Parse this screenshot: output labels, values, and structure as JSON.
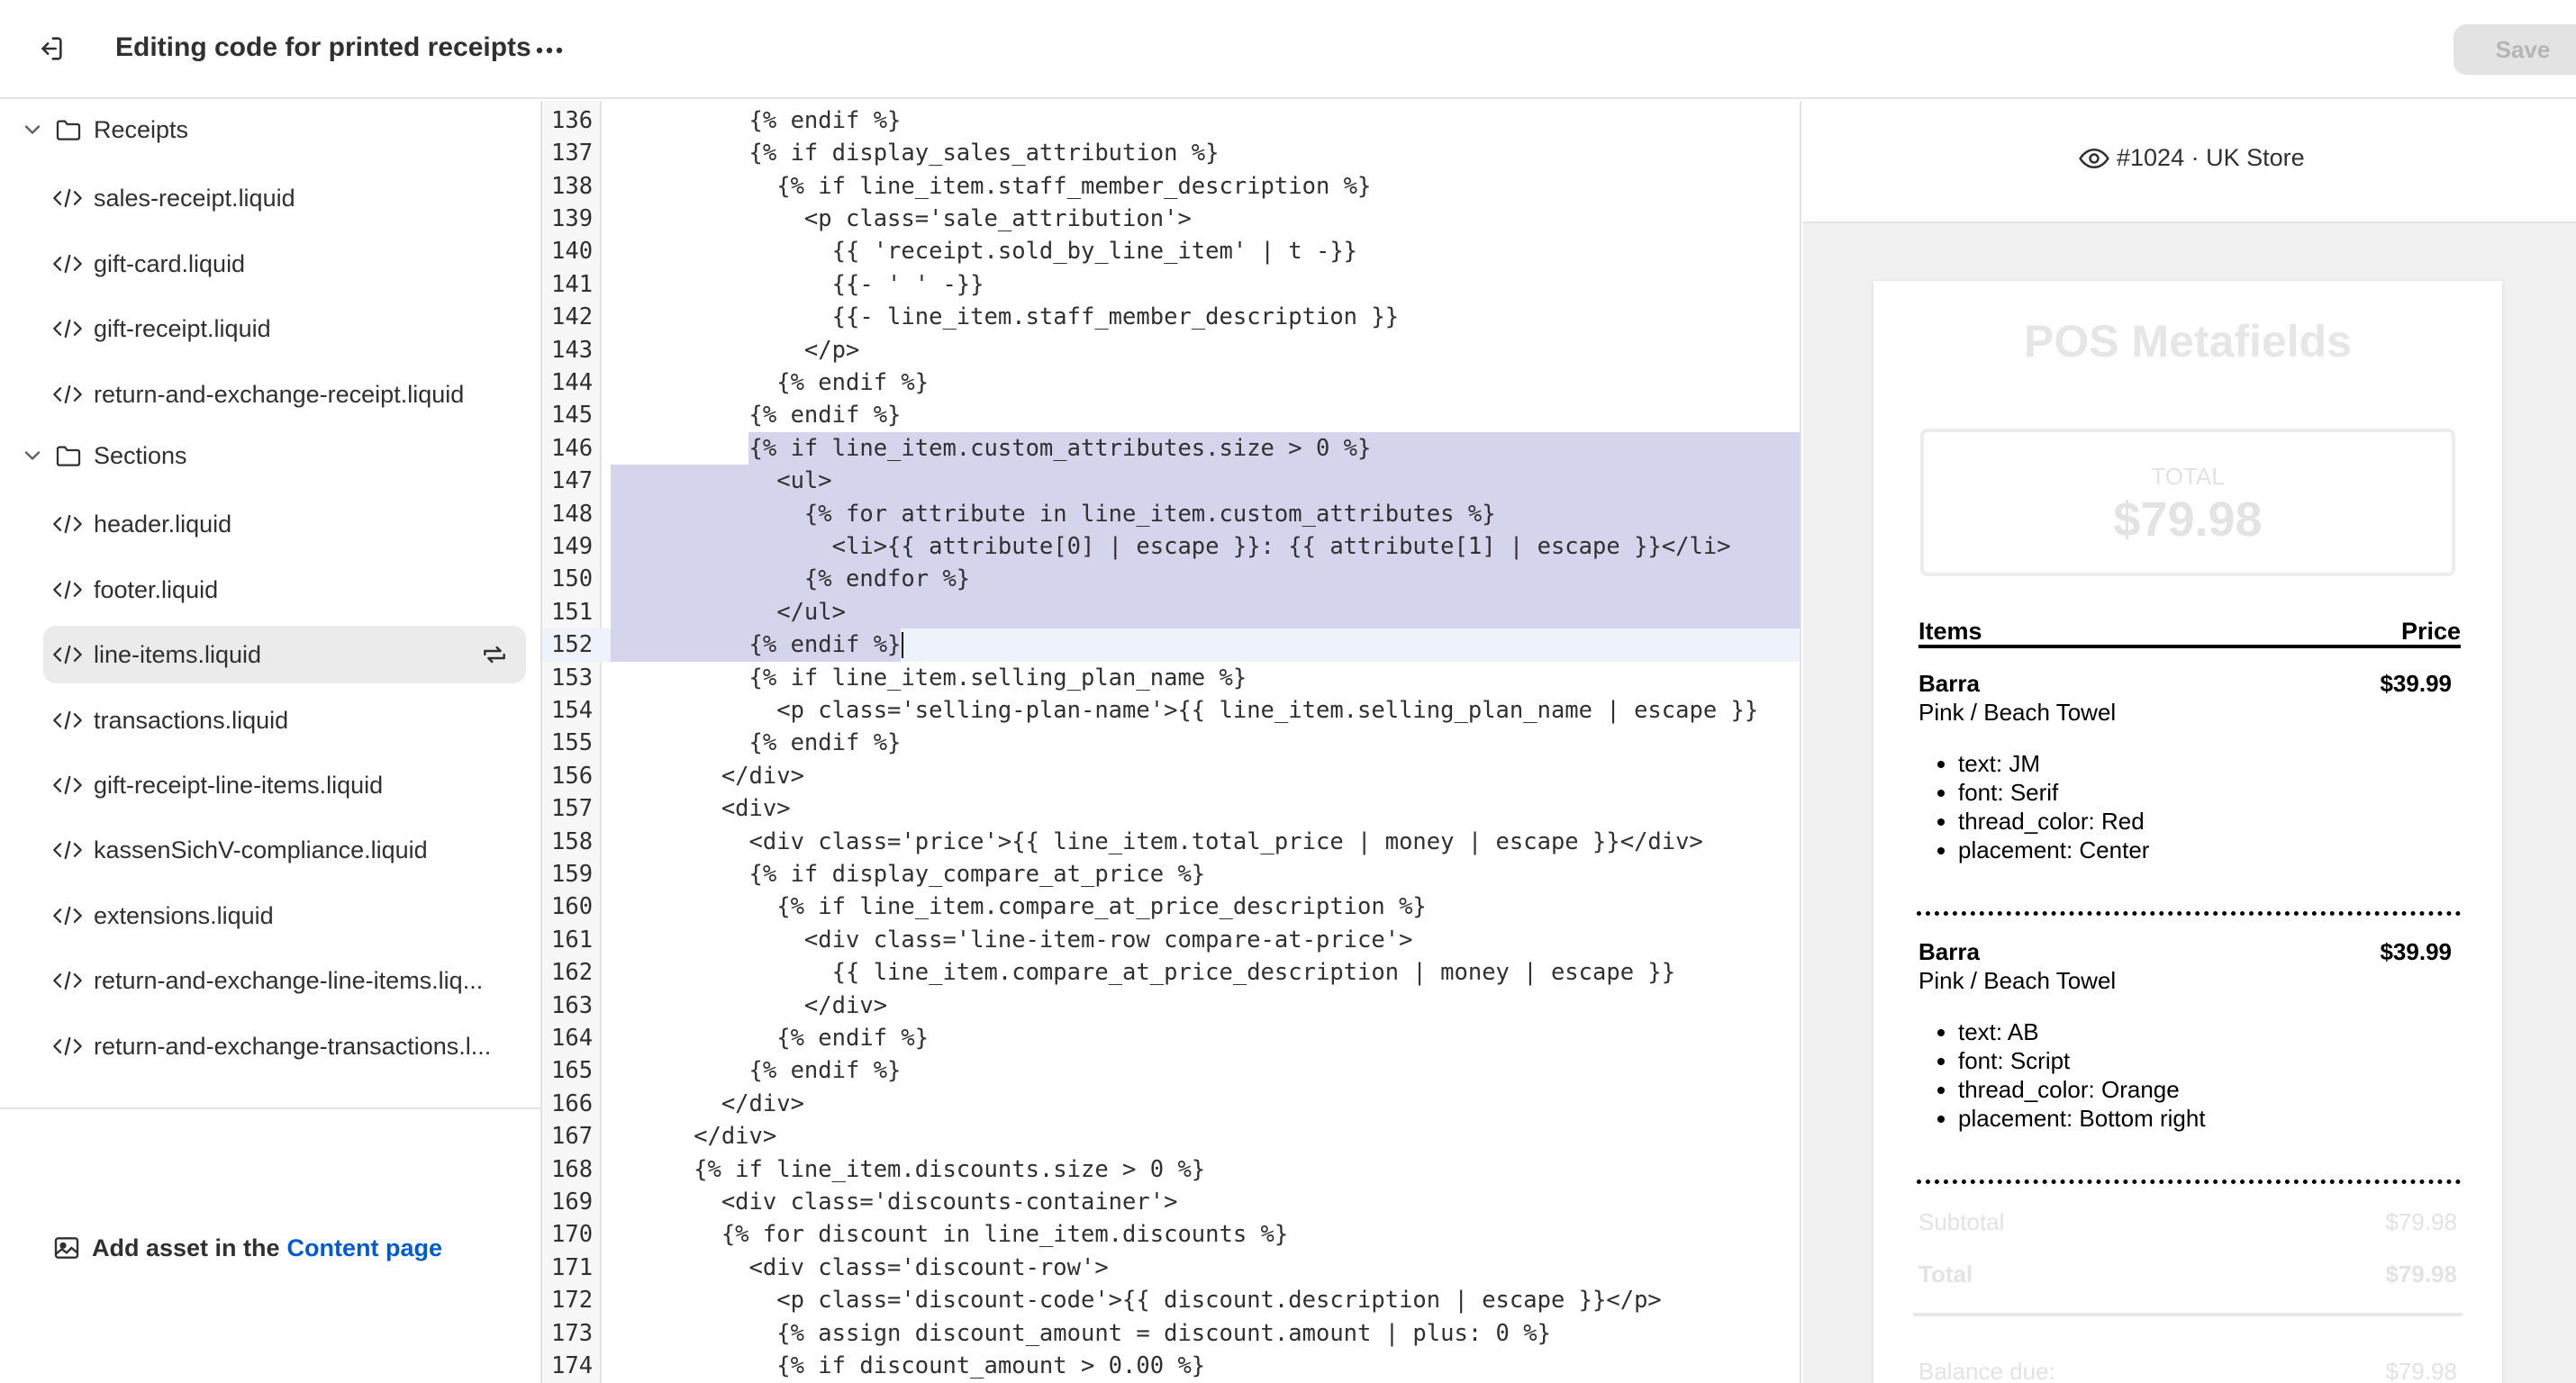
{
  "header": {
    "title": "Editing code for printed receipts",
    "save_label": "Save"
  },
  "sidebar": {
    "folders": [
      {
        "name": "Receipts",
        "files": [
          "sales-receipt.liquid",
          "gift-card.liquid",
          "gift-receipt.liquid",
          "return-and-exchange-receipt.liquid"
        ]
      },
      {
        "name": "Sections",
        "files": [
          "header.liquid",
          "footer.liquid",
          "line-items.liquid",
          "transactions.liquid",
          "gift-receipt-line-items.liquid",
          "kassenSichV-compliance.liquid",
          "extensions.liquid",
          "return-and-exchange-line-items.liq...",
          "return-and-exchange-transactions.l..."
        ]
      }
    ],
    "active_file": "line-items.liquid",
    "add_asset_prefix": "Add asset in the",
    "add_asset_link": "Content page"
  },
  "editor": {
    "first_line": 136,
    "lines": [
      "          {% endif %}",
      "          {% if display_sales_attribution %}",
      "            {% if line_item.staff_member_description %}",
      "              <p class='sale_attribution'>",
      "                {{ 'receipt.sold_by_line_item' | t -}}",
      "                {{- ' ' -}}",
      "                {{- line_item.staff_member_description }}",
      "              </p>",
      "            {% endif %}",
      "          {% endif %}",
      "          {% if line_item.custom_attributes.size > 0 %}",
      "            <ul>",
      "              {% for attribute in line_item.custom_attributes %}",
      "                <li>{{ attribute[0] | escape }}: {{ attribute[1] | escape }}</li>",
      "              {% endfor %}",
      "            </ul>",
      "          {% endif %}",
      "          {% if line_item.selling_plan_name %}",
      "            <p class='selling-plan-name'>{{ line_item.selling_plan_name | escape }}",
      "          {% endif %}",
      "        </div>",
      "        <div>",
      "          <div class='price'>{{ line_item.total_price | money | escape }}</div>",
      "          {% if display_compare_at_price %}",
      "            {% if line_item.compare_at_price_description %}",
      "              <div class='line-item-row compare-at-price'>",
      "                {{ line_item.compare_at_price_description | money | escape }}",
      "              </div>",
      "            {% endif %}",
      "          {% endif %}",
      "        </div>",
      "      </div>",
      "      {% if line_item.discounts.size > 0 %}",
      "        <div class='discounts-container'>",
      "        {% for discount in line_item.discounts %}",
      "          <div class='discount-row'>",
      "            <p class='discount-code'>{{ discount.description | escape }}</p>",
      "            {% assign discount_amount = discount.amount | plus: 0 %}",
      "            {% if discount_amount > 0.00 %}"
    ]
  },
  "preview": {
    "store_label": "#1024 · UK Store",
    "receipt_title": "POS Metafields",
    "total_label": "TOTAL",
    "total_value": "$79.98",
    "items_header": "Items",
    "price_header": "Price",
    "items": [
      {
        "name": "Barra",
        "price": "$39.99",
        "variant": "Pink / Beach Towel",
        "attributes": [
          "text: JM",
          "font: Serif",
          "thread_color: Red",
          "placement: Center"
        ]
      },
      {
        "name": "Barra",
        "price": "$39.99",
        "variant": "Pink / Beach Towel",
        "attributes": [
          "text: AB",
          "font: Script",
          "thread_color: Orange",
          "placement: Bottom right"
        ]
      }
    ],
    "subtotal_label": "Subtotal",
    "subtotal_value": "$79.98",
    "total_row_label": "Total",
    "total_row_value": "$79.98",
    "balance_label": "Balance due:",
    "balance_value": "$79.98"
  },
  "icons": {
    "exit": "exit-icon",
    "more": "more-horizontal-icon",
    "chevron": "chevron-down-icon",
    "folder": "folder-icon",
    "code": "code-icon",
    "sync": "sync-icon",
    "image": "image-icon",
    "eye": "eye-icon"
  },
  "colors": {
    "link": "#005bd3",
    "selection": "#d4d5ec",
    "save_disabled_bg": "#e3e3e3"
  }
}
